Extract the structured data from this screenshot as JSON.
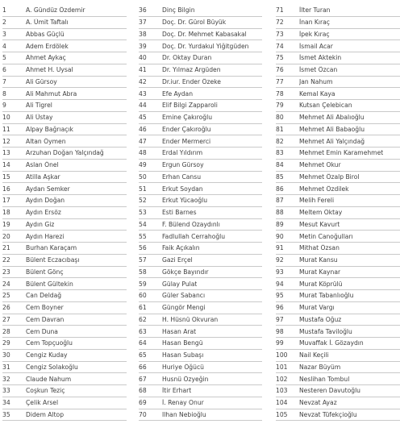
{
  "columns": [
    {
      "rows": [
        {
          "num": "1",
          "name": "A. Gündüz Özdemir"
        },
        {
          "num": "2",
          "name": "A. Ümit Taftalı"
        },
        {
          "num": "3",
          "name": "Abbas Güçlü"
        },
        {
          "num": "4",
          "name": "Adem Erdölek"
        },
        {
          "num": "5",
          "name": "Ahmet Aykaç"
        },
        {
          "num": "6",
          "name": "Ahmet H. Uysal"
        },
        {
          "num": "7",
          "name": "Ali Gürsoy"
        },
        {
          "num": "8",
          "name": "Ali Mahmut Abra"
        },
        {
          "num": "9",
          "name": "Ali Tigrel"
        },
        {
          "num": "10",
          "name": "Ali Üstay"
        },
        {
          "num": "11",
          "name": "Alpay Bağrıaçık"
        },
        {
          "num": "12",
          "name": "Altan Öymen"
        },
        {
          "num": "13",
          "name": "Arzuhan Doğan Yalçındağ"
        },
        {
          "num": "14",
          "name": "Aslan Önel"
        },
        {
          "num": "15",
          "name": "Atilla Aşkar"
        },
        {
          "num": "16",
          "name": "Aydan Semker"
        },
        {
          "num": "17",
          "name": "Aydın Doğan"
        },
        {
          "num": "18",
          "name": "Aydın Ersöz"
        },
        {
          "num": "19",
          "name": "Aydın Giz"
        },
        {
          "num": "20",
          "name": "Aydın Harezi"
        },
        {
          "num": "21",
          "name": "Burhan Karaçam"
        },
        {
          "num": "22",
          "name": "Bülent Eczacıbaşı"
        },
        {
          "num": "23",
          "name": "Bülent Gönç"
        },
        {
          "num": "24",
          "name": "Bülent Gültekin"
        },
        {
          "num": "25",
          "name": "Can Deldağ"
        },
        {
          "num": "26",
          "name": "Cem Boyner"
        },
        {
          "num": "27",
          "name": "Cem Davran"
        },
        {
          "num": "28",
          "name": "Cem Duna"
        },
        {
          "num": "29",
          "name": "Cem Topçuoğlu"
        },
        {
          "num": "30",
          "name": "Cengiz Kuday"
        },
        {
          "num": "31",
          "name": "Cengiz Solakoğlu"
        },
        {
          "num": "32",
          "name": "Claude Nahum"
        },
        {
          "num": "33",
          "name": "Coşkun Teziç"
        },
        {
          "num": "34",
          "name": "Çelik Arsel"
        },
        {
          "num": "35",
          "name": "Didem Altop"
        }
      ]
    },
    {
      "rows": [
        {
          "num": "36",
          "name": "Dinç Bilgin"
        },
        {
          "num": "37",
          "name": "Doç. Dr. Gürol Büyük"
        },
        {
          "num": "38",
          "name": "Doç. Dr. Mehmet Kabasakal"
        },
        {
          "num": "39",
          "name": "Doç. Dr. Yurdakul Yiğitgüden"
        },
        {
          "num": "40",
          "name": "Dr. Oktay Duran"
        },
        {
          "num": "41",
          "name": "Dr. Yılmaz Argüden"
        },
        {
          "num": "42",
          "name": "Dr.iur. Ender Özeke"
        },
        {
          "num": "43",
          "name": "Efe Aydan"
        },
        {
          "num": "44",
          "name": "Elif Bilgi Zapparoli"
        },
        {
          "num": "45",
          "name": "Emine Çakıroğlu"
        },
        {
          "num": "46",
          "name": "Ender Çakıroğlu"
        },
        {
          "num": "47",
          "name": "Ender Mermerci"
        },
        {
          "num": "48",
          "name": "Erdal Yıldırım"
        },
        {
          "num": "49",
          "name": "Ergun Gürsoy"
        },
        {
          "num": "50",
          "name": "Erhan Cansu"
        },
        {
          "num": "51",
          "name": "Erkut Soydan"
        },
        {
          "num": "52",
          "name": "Erkut Yücaoğlu"
        },
        {
          "num": "53",
          "name": "Esti Barnes"
        },
        {
          "num": "54",
          "name": "F. Bülend Ozaydınlı"
        },
        {
          "num": "55",
          "name": "Fadlullah Cerrahoğlu"
        },
        {
          "num": "56",
          "name": "Faik Açıkalın"
        },
        {
          "num": "57",
          "name": "Gazi Erçel"
        },
        {
          "num": "58",
          "name": "Gökçe Bayındır"
        },
        {
          "num": "59",
          "name": "Gülay Pulat"
        },
        {
          "num": "60",
          "name": "Güler Sabancı"
        },
        {
          "num": "61",
          "name": "Güngör Mengi"
        },
        {
          "num": "62",
          "name": "H. Hüsnü Okvuran"
        },
        {
          "num": "63",
          "name": "Hasan Arat"
        },
        {
          "num": "64",
          "name": "Hasan Bengü"
        },
        {
          "num": "65",
          "name": "Hasan Subaşı"
        },
        {
          "num": "66",
          "name": "Huriye Öğücü"
        },
        {
          "num": "67",
          "name": "Husnü Özyeğin"
        },
        {
          "num": "68",
          "name": "İtir Erhart"
        },
        {
          "num": "69",
          "name": "İ. Renay Onur"
        },
        {
          "num": "70",
          "name": "Ilhan Nebioğlu"
        }
      ]
    },
    {
      "rows": [
        {
          "num": "71",
          "name": "İlter Turan"
        },
        {
          "num": "72",
          "name": "İnan Kıraç"
        },
        {
          "num": "73",
          "name": "İpek Kıraç"
        },
        {
          "num": "74",
          "name": "İsmail Acar"
        },
        {
          "num": "75",
          "name": "İsmet Aktekin"
        },
        {
          "num": "76",
          "name": "İsmet Özcan"
        },
        {
          "num": "77",
          "name": "Jan Nahum"
        },
        {
          "num": "78",
          "name": "Kemal Kaya"
        },
        {
          "num": "79",
          "name": "Kutsan Çelebican"
        },
        {
          "num": "80",
          "name": "Mehmet Ali Abalıoğlu"
        },
        {
          "num": "81",
          "name": "Mehmet Ali Babaoğlu"
        },
        {
          "num": "82",
          "name": "Mehmet Ali Yalçındağ"
        },
        {
          "num": "83",
          "name": "Mehmet Emin Karamehmet"
        },
        {
          "num": "84",
          "name": "Mehmet Okur"
        },
        {
          "num": "85",
          "name": "Mehmet Özalp Birol"
        },
        {
          "num": "86",
          "name": "Mehmet Özdilek"
        },
        {
          "num": "87",
          "name": "Melih Fereli"
        },
        {
          "num": "88",
          "name": "Meltem Oktay"
        },
        {
          "num": "89",
          "name": "Mesut Kavurt"
        },
        {
          "num": "90",
          "name": "Metin Canoğulları"
        },
        {
          "num": "91",
          "name": "Mithat Özsan"
        },
        {
          "num": "92",
          "name": "Murat Kansu"
        },
        {
          "num": "93",
          "name": "Murat Kaynar"
        },
        {
          "num": "94",
          "name": "Murat Köprülü"
        },
        {
          "num": "95",
          "name": "Murat Tabanlıoğlu"
        },
        {
          "num": "96",
          "name": "Murat Vargı"
        },
        {
          "num": "97",
          "name": "Mustafa Oğuz"
        },
        {
          "num": "98",
          "name": "Mustafa Taviloğlu"
        },
        {
          "num": "99",
          "name": "Muvaffak İ. Gözaydın"
        },
        {
          "num": "100",
          "name": "Nail Keçili"
        },
        {
          "num": "101",
          "name": "Nazar Büyüm"
        },
        {
          "num": "102",
          "name": "Neslihan Tombul"
        },
        {
          "num": "103",
          "name": "Nesteren Davutoğlu"
        },
        {
          "num": "104",
          "name": "Nevzat Ayaz"
        },
        {
          "num": "105",
          "name": "Nevzat Tüfekçioğlu"
        }
      ]
    }
  ]
}
